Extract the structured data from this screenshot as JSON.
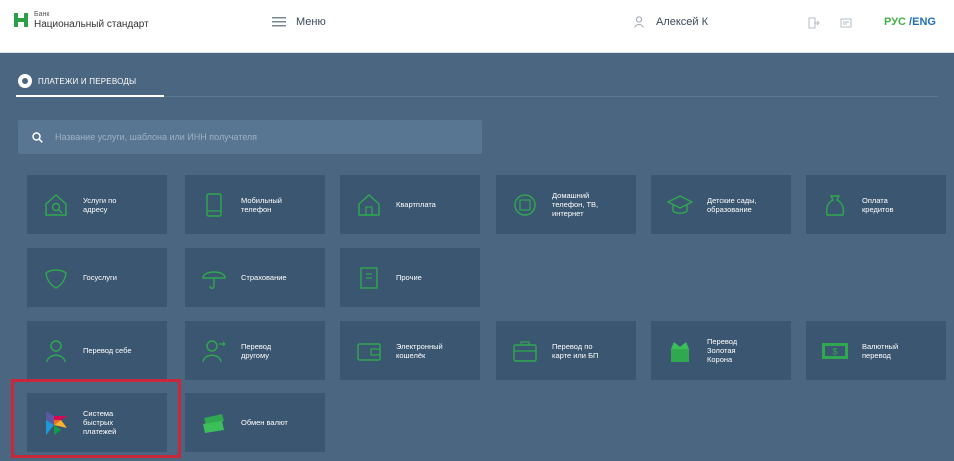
{
  "header": {
    "logo_small": "Банк",
    "logo_main": "Национальный стандарт",
    "menu_label": "Меню",
    "user_name": "Алексей К",
    "lang_ru": "РУС",
    "lang_sep": " /",
    "lang_en": "ENG"
  },
  "tab": {
    "label": "ПЛАТЕЖИ И ПЕРЕВОДЫ"
  },
  "search": {
    "placeholder": "Название услуги, шаблона или ИНН получателя"
  },
  "tiles": [
    {
      "label": "Услуги по\nадресу",
      "icon": "house-search-icon"
    },
    {
      "label": "Мобильный\nтелефон",
      "icon": "mobile-phone-icon"
    },
    {
      "label": "Квартплата",
      "icon": "house-icon"
    },
    {
      "label": "Домашний\nтелефон, ТВ,\nинтернет",
      "icon": "globe-phone-icon"
    },
    {
      "label": "Детские сады,\nобразование",
      "icon": "graduation-cap-icon"
    },
    {
      "label": "Оплата\nкредитов",
      "icon": "money-bag-icon"
    },
    {
      "label": "Госуслуги",
      "icon": "emblem-icon"
    },
    {
      "label": "Страхование",
      "icon": "umbrella-icon"
    },
    {
      "label": "Прочие",
      "icon": "document-icon"
    },
    {
      "label": "Перевод себе",
      "icon": "person-icon"
    },
    {
      "label": "Перевод\nдругому",
      "icon": "person-transfer-icon"
    },
    {
      "label": "Электронный\nкошелёк",
      "icon": "wallet-icon"
    },
    {
      "label": "Перевод по\nкарте или БП",
      "icon": "briefcase-card-icon"
    },
    {
      "label": "Перевод\nЗолотая\nКорона",
      "icon": "crown-gift-icon"
    },
    {
      "label": "Валютный\nперевод",
      "icon": "banknote-icon"
    },
    {
      "label": "Система\nбыстрых\nплатежей",
      "icon": "sbp-logo-icon"
    },
    {
      "label": "Обмен валют",
      "icon": "currency-exchange-icon"
    }
  ],
  "colors": {
    "accent_green": "#47b04b",
    "accent_blue": "#1d6fb8",
    "highlight_red": "#c8283a"
  }
}
